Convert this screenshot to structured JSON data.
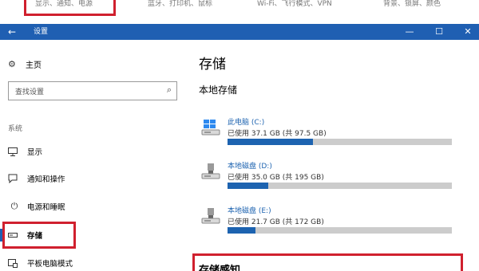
{
  "previous_categories": {
    "system": "显示、通知、电源",
    "devices": "蓝牙、打印机、鼠标",
    "network": "Wi-Fi、飞行模式、VPN",
    "personalization": "背景、锁屏、颜色"
  },
  "window": {
    "title": "设置",
    "back_icon": "←",
    "minimize_icon": "—",
    "maximize_icon": "☐",
    "close_icon": "✕",
    "accent_color": "#1f5fb2"
  },
  "sidebar": {
    "home_label": "主页",
    "search_placeholder": "查找设置",
    "section_label": "系统",
    "items": [
      {
        "label": "显示",
        "icon": "monitor-icon"
      },
      {
        "label": "通知和操作",
        "icon": "notification-icon"
      },
      {
        "label": "电源和睡眠",
        "icon": "power-icon"
      },
      {
        "label": "存储",
        "icon": "storage-icon",
        "active": true
      },
      {
        "label": "平板电脑模式",
        "icon": "tablet-icon"
      }
    ]
  },
  "main": {
    "title": "存储",
    "local_storage_title": "本地存储",
    "drives": [
      {
        "name": "此电脑 (C:)",
        "usage": "已使用 37.1 GB (共 97.5 GB)",
        "used_fraction": 0.38,
        "icon": "windows-drive-icon"
      },
      {
        "name": "本地磁盘 (D:)",
        "usage": "已使用 35.0 GB (共 195 GB)",
        "used_fraction": 0.18,
        "icon": "usb-drive-icon"
      },
      {
        "name": "本地磁盘 (E:)",
        "usage": "已使用 21.7 GB (共 172 GB)",
        "used_fraction": 0.126,
        "icon": "usb-drive-icon"
      }
    ],
    "storage_sense_title": "存储感知"
  },
  "colors": {
    "highlight_red": "#d0202e",
    "bar_fill": "#1d63b0",
    "bar_track": "#cccccc"
  }
}
